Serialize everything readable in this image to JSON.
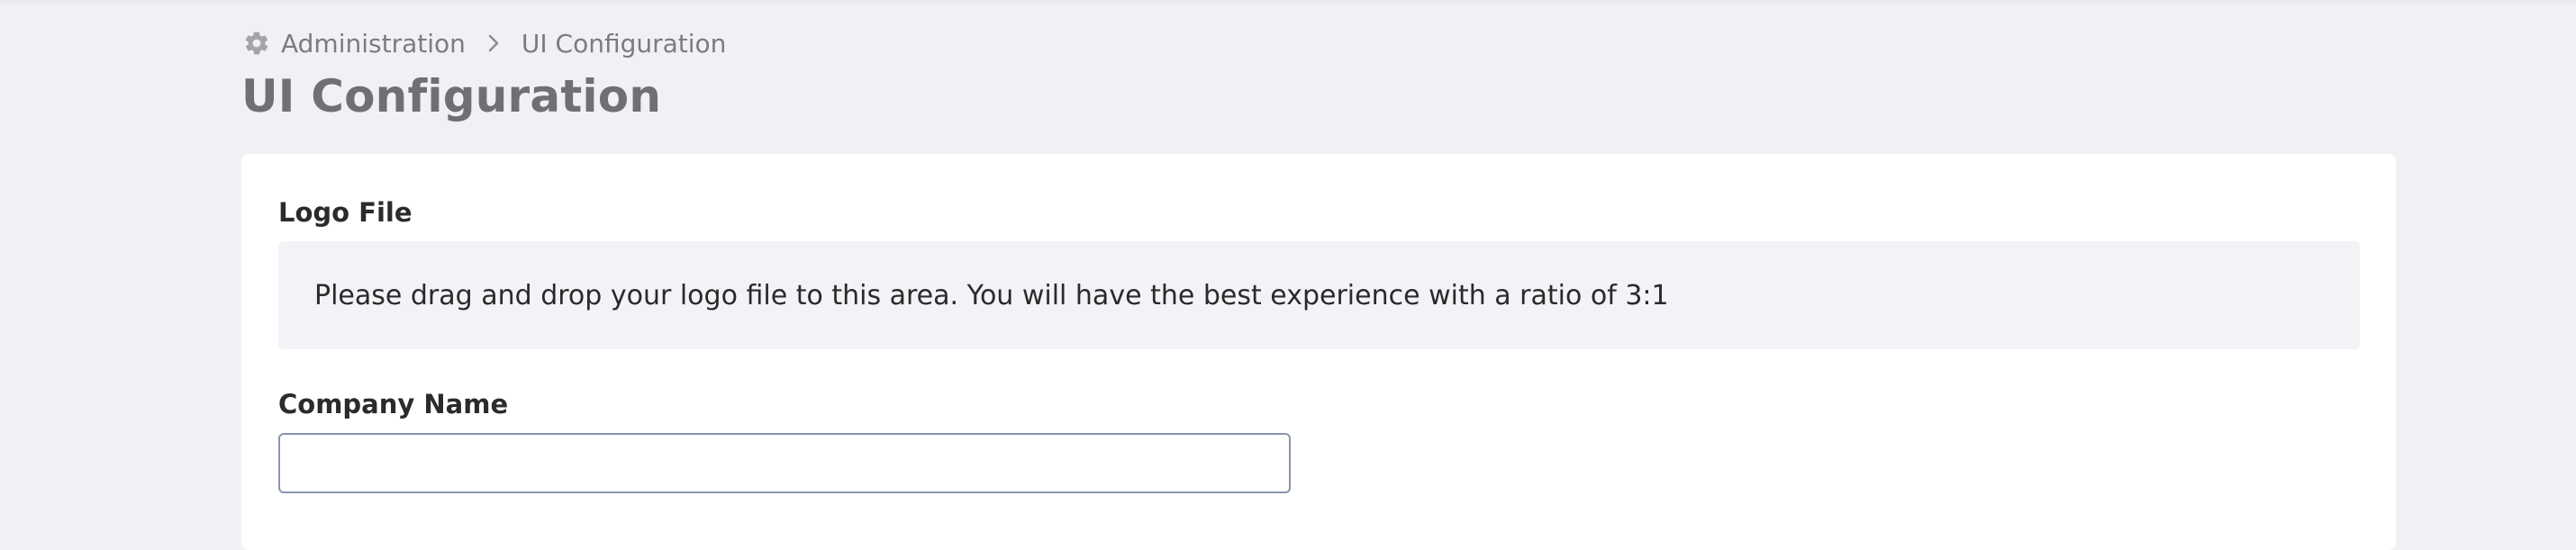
{
  "breadcrumb": {
    "icon": "gear-icon",
    "items": [
      {
        "label": "Administration"
      },
      {
        "label": "UI Configuration"
      }
    ],
    "separator_icon": "chevron-right-icon"
  },
  "page": {
    "title": "UI Configuration"
  },
  "form": {
    "logo": {
      "label": "Logo File",
      "dropzone_text": "Please drag and drop your logo file to this area. You will have the best experience with a ratio of 3:1"
    },
    "company": {
      "label": "Company Name",
      "value": "",
      "placeholder": ""
    }
  },
  "colors": {
    "background": "#f0f1f4",
    "card": "#ffffff",
    "dropzone": "#f2f3f6",
    "input_border": "#8796ad",
    "title": "#6f7073"
  }
}
